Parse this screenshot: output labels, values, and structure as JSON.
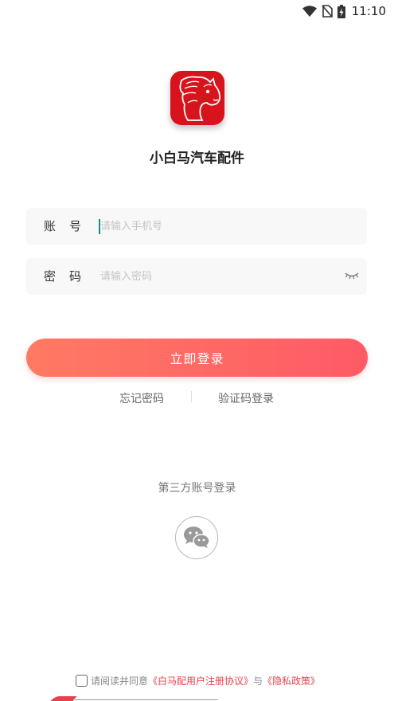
{
  "status_bar": {
    "time": "11:10",
    "icons": [
      "wifi-icon",
      "no-sim-icon",
      "battery-charging-icon"
    ]
  },
  "app": {
    "name": "小白马汽车配件",
    "logo_icon": "horse-head-logo-icon",
    "brand_color": "#d7141b"
  },
  "form": {
    "account": {
      "label": "账号",
      "placeholder": "请输入手机号",
      "value": ""
    },
    "password": {
      "label": "密码",
      "placeholder": "请输入密码",
      "value": "",
      "toggle_icon": "eye-closed-icon"
    }
  },
  "login_button": {
    "label": "立即登录"
  },
  "links": {
    "forgot_password": "忘记密码",
    "sms_login": "验证码登录"
  },
  "third_party": {
    "title": "第三方账号登录",
    "wechat_icon": "wechat-icon"
  },
  "agreement": {
    "checked": false,
    "prefix": "请阅读并同意",
    "user_agreement": "《白马配用户注册协议》",
    "conjunction": "与",
    "privacy_policy": "《隐私政策》",
    "link_color": "#e8414b"
  },
  "colors": {
    "button_gradient_start": "#ff7a63",
    "button_gradient_end": "#ff5a66",
    "cursor": "#1d8c87"
  }
}
